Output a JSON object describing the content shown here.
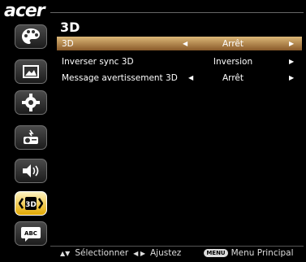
{
  "brand": "acer",
  "menu_title": "3D",
  "sidebar": {
    "icons": [
      "palette-icon",
      "image-icon",
      "gear-icon",
      "projector-icon",
      "speaker-icon",
      "3d-icon",
      "language-icon"
    ],
    "3d_label": "3D",
    "abc_label": "ABC",
    "selected": "3d-icon"
  },
  "options": [
    {
      "label": "3D",
      "value": "Arrêt",
      "left_arrow": "◀",
      "right_arrow": "▶",
      "selected": true
    },
    {
      "label": "Inverser sync 3D",
      "value": "Inversion",
      "left_arrow": "",
      "right_arrow": "▶",
      "selected": false
    },
    {
      "label": "Message avertissement 3D",
      "value": "Arrêt",
      "left_arrow": "◀",
      "right_arrow": "▶",
      "selected": false
    }
  ],
  "footer": {
    "nav_glyph": "▲▼",
    "select_label": "Sélectionner",
    "adjust_glyph": "◀ ▶",
    "adjust_label": "Ajustez",
    "menu_key": "MENU",
    "menu_label": "Menu Principal"
  },
  "colors": {
    "selected_row": "#c29a60",
    "selected_icon": "#f0c020",
    "background": "#000000"
  }
}
